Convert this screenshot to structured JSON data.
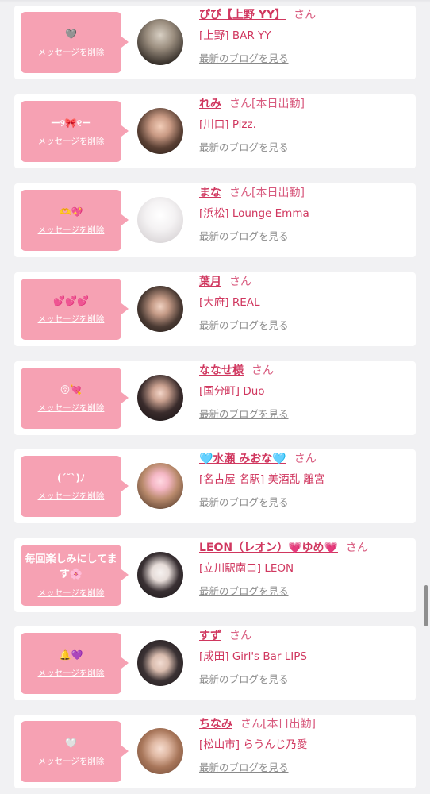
{
  "delete_label": "メッセージを削除",
  "blog_label": "最新のブログを見る",
  "san": "さん",
  "items": [
    {
      "message": "🩶",
      "name": "ぴぴ【上野 YY】",
      "badge": "",
      "shop": "[上野] BAR YY"
    },
    {
      "message": "ー୨🎀୧ー",
      "name": "れみ",
      "badge": "[本日出勤]",
      "shop": "[川口] Pizz."
    },
    {
      "message": "🫶💖",
      "name": "まな",
      "badge": "[本日出勤]",
      "shop": "[浜松] Lounge Emma"
    },
    {
      "message": "💕💕💕",
      "name": "葉月",
      "badge": "",
      "shop": "[大府] REAL"
    },
    {
      "message": "😚💘",
      "name": "ななせ様",
      "badge": "",
      "shop": "[国分町] Duo"
    },
    {
      "message": "(´˘`)ﾉ",
      "name": "🩵水瀬 みおな🩵",
      "badge": "",
      "shop": "[名古屋 名駅] 美酒乱 離宮"
    },
    {
      "message": "毎回楽しみにしてます🌸",
      "name": "LEON（レオン）💗ゆめ💗",
      "badge": "",
      "shop": "[立川駅南口] LEON"
    },
    {
      "message": "🔔💜",
      "name": "すず",
      "badge": "",
      "shop": "[成田] Girl's Bar LIPS"
    },
    {
      "message": "🤍",
      "name": "ちなみ",
      "badge": "[本日出勤]",
      "shop": "[松山市] らうんじ乃愛"
    }
  ]
}
